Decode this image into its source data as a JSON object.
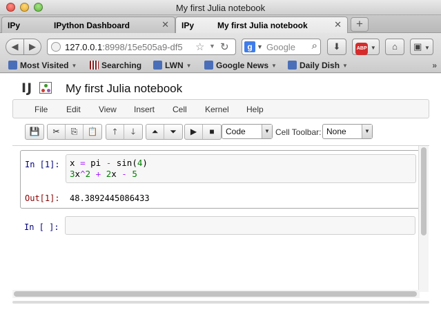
{
  "window": {
    "title": "My first Julia notebook"
  },
  "tabs": [
    {
      "favicon": "IPy",
      "label": "IPython Dashboard",
      "close": "✕"
    },
    {
      "favicon": "IPy",
      "label": "My first Julia notebook",
      "close": "✕"
    }
  ],
  "new_tab": "+",
  "nav": {
    "back": "◀",
    "forward": "▶",
    "url_host": "127.0.0.1",
    "url_rest": ":8998/15e505a9-df5",
    "search_engine": "g",
    "search_placeholder": "Google"
  },
  "bookmarks": [
    {
      "label": "Most Visited",
      "icon": "folder-icon",
      "has_menu": true
    },
    {
      "label": "Searching",
      "icon": "bookmark-icon",
      "has_menu": false
    },
    {
      "label": "LWN",
      "icon": "rss-icon",
      "has_menu": true
    },
    {
      "label": "Google News",
      "icon": "rss-icon",
      "has_menu": true
    },
    {
      "label": "Daily Dish",
      "icon": "rss-icon",
      "has_menu": true
    }
  ],
  "bookmarks_more": "»",
  "notebook": {
    "logo": "IJ",
    "title": "My first Julia notebook",
    "menu": [
      "File",
      "Edit",
      "View",
      "Insert",
      "Cell",
      "Kernel",
      "Help"
    ],
    "cell_type": "Code",
    "cell_toolbar_label": "Cell Toolbar:",
    "cell_toolbar_value": "None"
  },
  "cells": [
    {
      "in_prompt": "In [1]:",
      "line1": {
        "a": "x ",
        "b": "=",
        "c": " pi ",
        "d": "-",
        "e": " sin(",
        "f": "4",
        "g": ")"
      },
      "line2": {
        "a": "3",
        "b": "x",
        "c": "^",
        "d": "2",
        "e": " + ",
        "f": "2",
        "g": "x",
        "h": " - ",
        "i": "5"
      },
      "out_prompt": "Out[1]:",
      "output": "48.3892445086433"
    },
    {
      "in_prompt": "In [ ]:"
    }
  ],
  "colors": {
    "in_prompt": "#000080",
    "out_prompt": "#8b0000",
    "number": "#008000",
    "operator": "#aa22ff"
  }
}
